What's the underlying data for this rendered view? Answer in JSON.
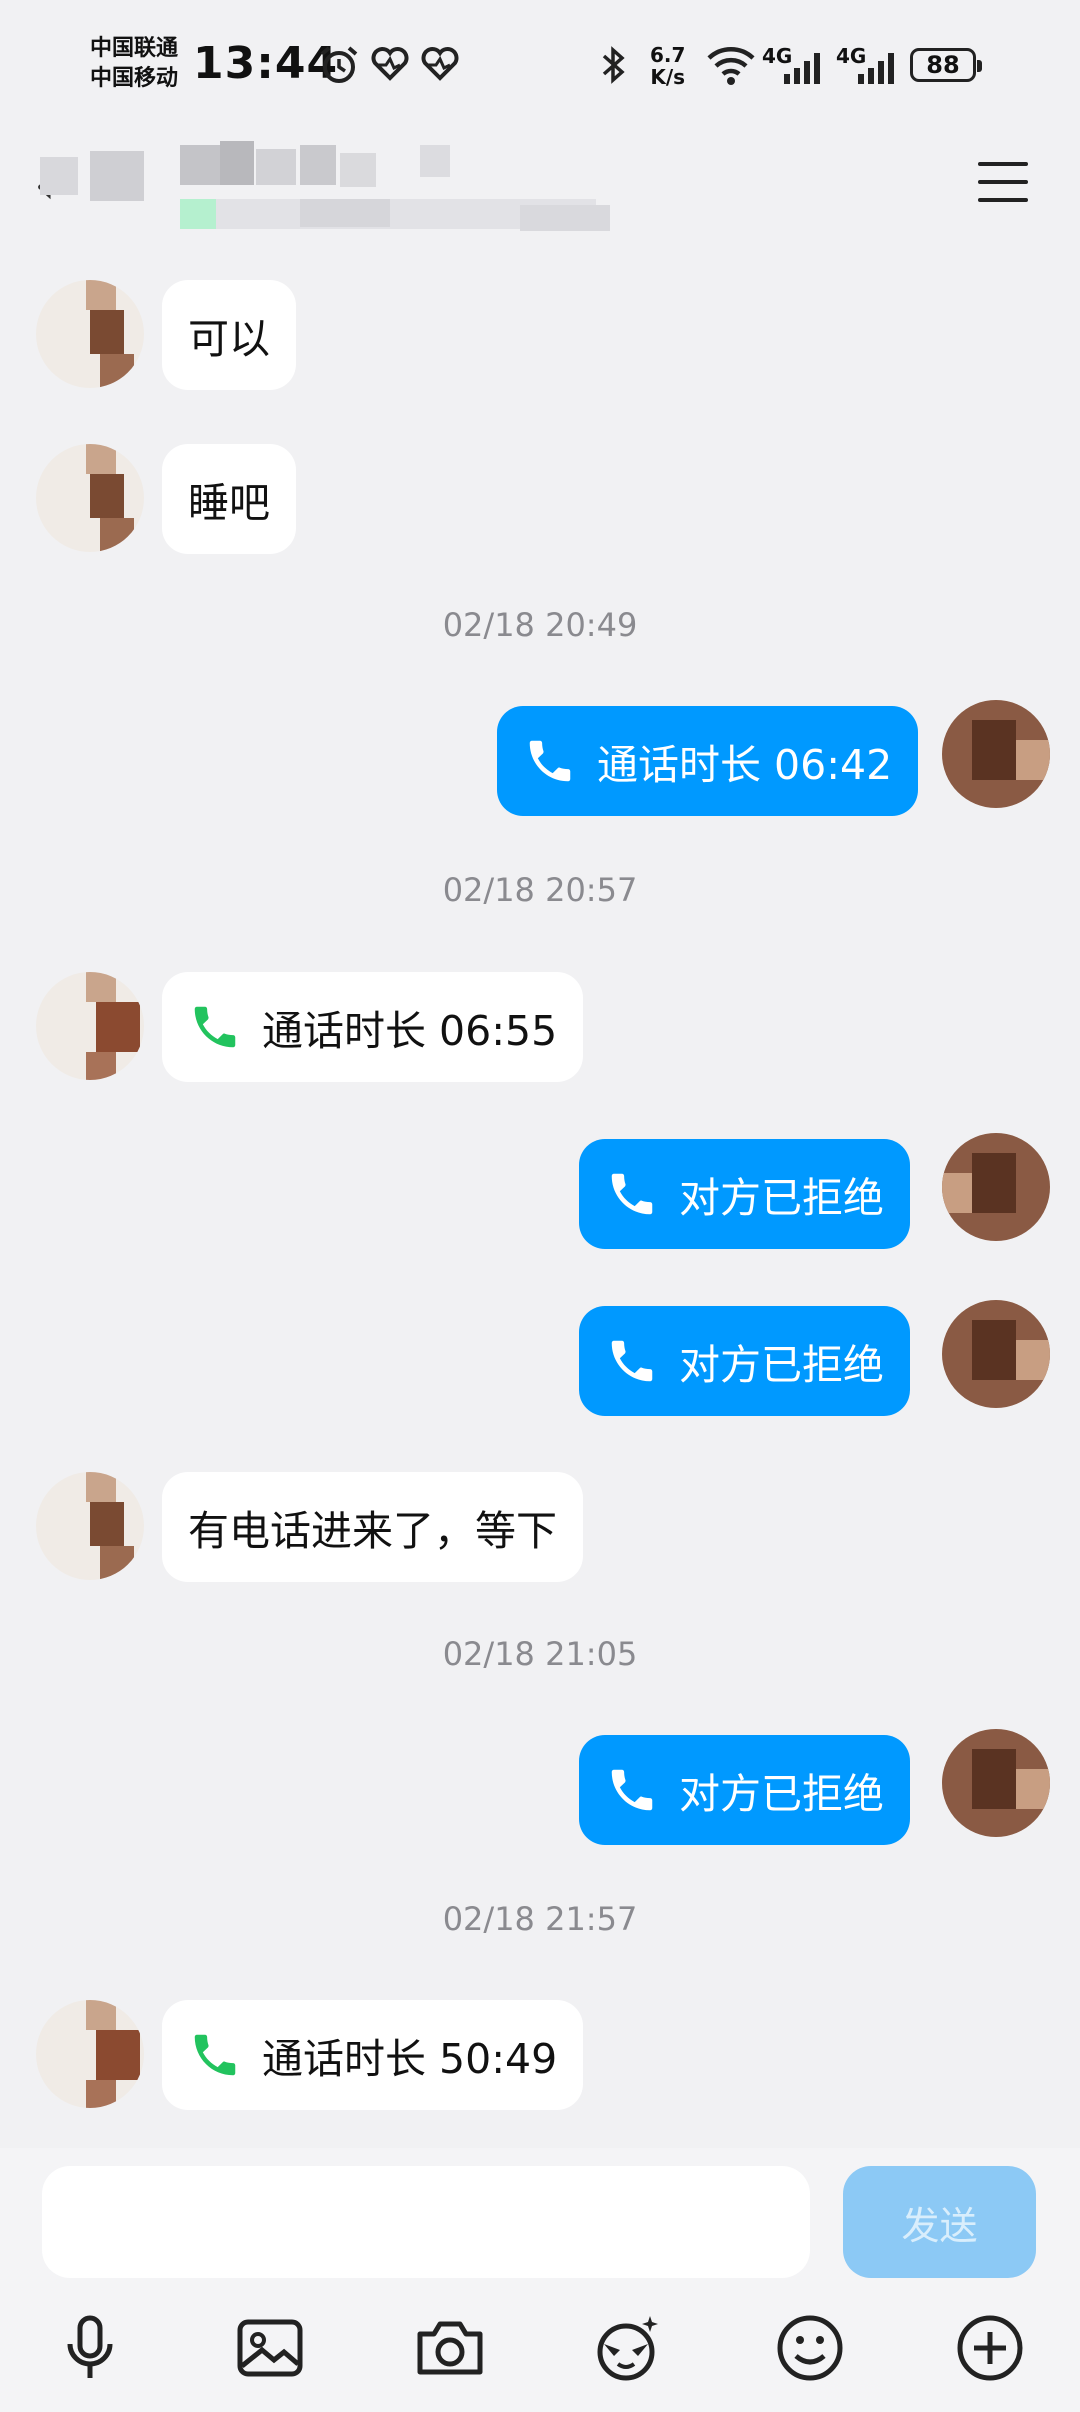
{
  "status_bar": {
    "carrier_1": "中国联通",
    "carrier_2": "中国移动",
    "time": "13:44",
    "speed_value": "6.7",
    "speed_unit": "K/s",
    "network_1": "4G",
    "network_2": "4G",
    "battery": "88"
  },
  "header": {
    "menu_icon": "hamburger-menu-icon"
  },
  "messages": [
    {
      "side": "in",
      "type": "text",
      "text": "可以"
    },
    {
      "side": "in",
      "type": "text",
      "text": "睡吧"
    },
    {
      "type": "timestamp",
      "text": "02/18 20:49"
    },
    {
      "side": "out",
      "type": "call",
      "text": "通话时长 06:42"
    },
    {
      "type": "timestamp",
      "text": "02/18 20:57"
    },
    {
      "side": "in",
      "type": "call",
      "text": "通话时长 06:55"
    },
    {
      "side": "out",
      "type": "call",
      "text": "对方已拒绝"
    },
    {
      "side": "out",
      "type": "call",
      "text": "对方已拒绝"
    },
    {
      "side": "in",
      "type": "text",
      "text": "有电话进来了，等下"
    },
    {
      "type": "timestamp",
      "text": "02/18 21:05"
    },
    {
      "side": "out",
      "type": "call",
      "text": "对方已拒绝"
    },
    {
      "type": "timestamp",
      "text": "02/18 21:57"
    },
    {
      "side": "in",
      "type": "call",
      "text": "通话时长 50:49"
    }
  ],
  "composer": {
    "input_value": "",
    "send_label": "发送"
  },
  "toolbar": {
    "icons": [
      "microphone-icon",
      "image-icon",
      "camera-icon",
      "face-filter-icon",
      "emoji-icon",
      "plus-icon"
    ]
  },
  "colors": {
    "background": "#f1f1f3",
    "outgoing_bubble": "#0099ff",
    "incoming_bubble": "#ffffff",
    "call_icon_green": "#22c35e",
    "send_button": "#8cc9f5",
    "timestamp": "#8a8a8f"
  }
}
